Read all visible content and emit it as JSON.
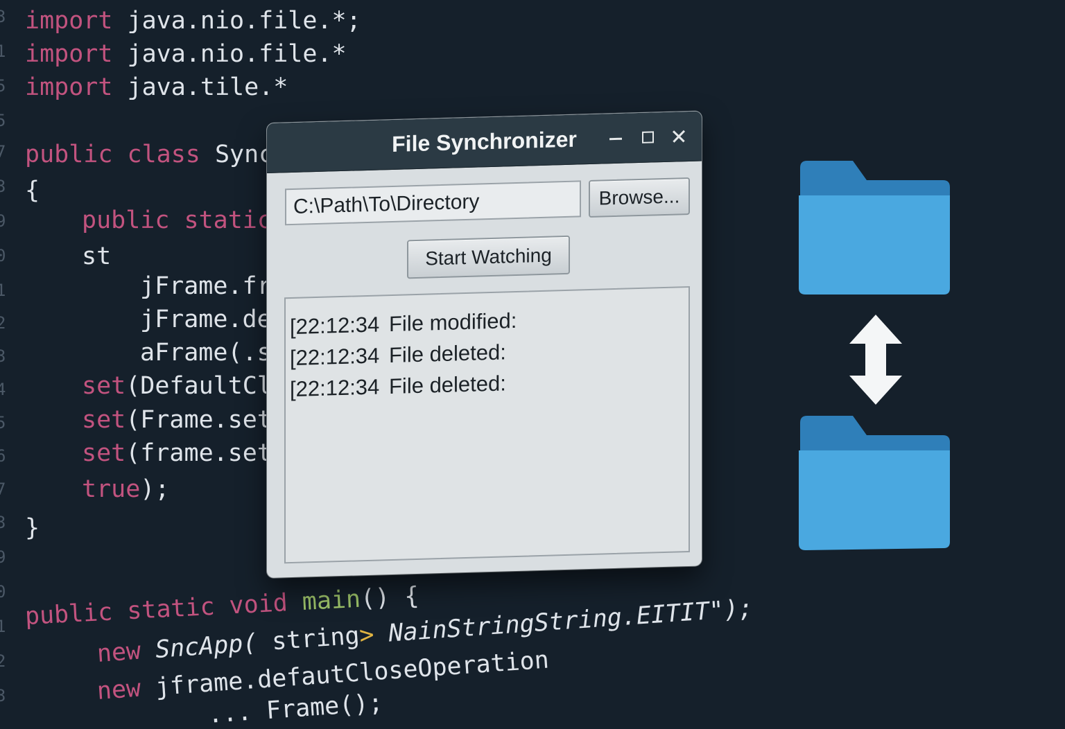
{
  "editor": {
    "gutter": [
      "3",
      "1",
      "5",
      "5",
      "7",
      "3",
      "9",
      "0",
      "1",
      "2",
      "3",
      "4",
      "5",
      "6",
      "7",
      "3",
      "9",
      "0",
      "1",
      "2",
      "3"
    ],
    "lines": [
      {
        "kw": "import",
        "rest": " java.nio.file.*;"
      },
      {
        "kw": "import",
        "rest": " java.nio.file.*"
      },
      {
        "kw": "import",
        "rest": " java.tile.*"
      },
      {
        "kw": "public class",
        "rest": " Sync"
      },
      {
        "kw": "",
        "rest": "{"
      },
      {
        "kw": "public static",
        "rest": ""
      },
      {
        "kw": "",
        "rest": "st"
      },
      {
        "kw": "",
        "rest": "jFrame.fr"
      },
      {
        "kw": "",
        "rest": "jFrame.de"
      },
      {
        "kw": "",
        "rest": "aFrame(.s"
      },
      {
        "kw": "set",
        "rest": "(DefaultCl"
      },
      {
        "kw": "set",
        "rest": "(Frame.set"
      },
      {
        "kw": "set",
        "rest": "(frame.set"
      },
      {
        "kw": "true",
        "rest": ");"
      },
      {
        "kw": "",
        "rest": "}"
      }
    ],
    "bottom": {
      "l1_kw": "public static void",
      "l1_fn": "main",
      "l1_rest": "() {",
      "l2_kw": "new",
      "l2_a": "SncApp(",
      "l2_b": " string",
      "l2_op": ">",
      "l2_c": " NainStringString.EITIT\");",
      "l3_kw": "new",
      "l3_rest": " jframe.defautCloseOperation",
      "l4_rest": "... Frame();"
    }
  },
  "window": {
    "title": "File Synchronizer",
    "path_value": "C:\\Path\\To\\Directory",
    "browse_label": "Browse...",
    "start_label": "Start Watching",
    "log": [
      {
        "time": "[22:12:34",
        "message": "File modified:"
      },
      {
        "time": "[22:12:34",
        "message": "File deleted:"
      },
      {
        "time": "[22:12:34",
        "message": "File deleted:"
      }
    ]
  },
  "icons": {
    "folder_top": "folder-icon",
    "folder_bottom": "folder-icon",
    "sync_arrow": "up-down-arrow-icon"
  },
  "colors": {
    "background": "#15202b",
    "keyword": "#c2537f",
    "function": "#9ec46a",
    "folder_front": "#4aa8e0",
    "folder_back": "#2f7fb9"
  }
}
